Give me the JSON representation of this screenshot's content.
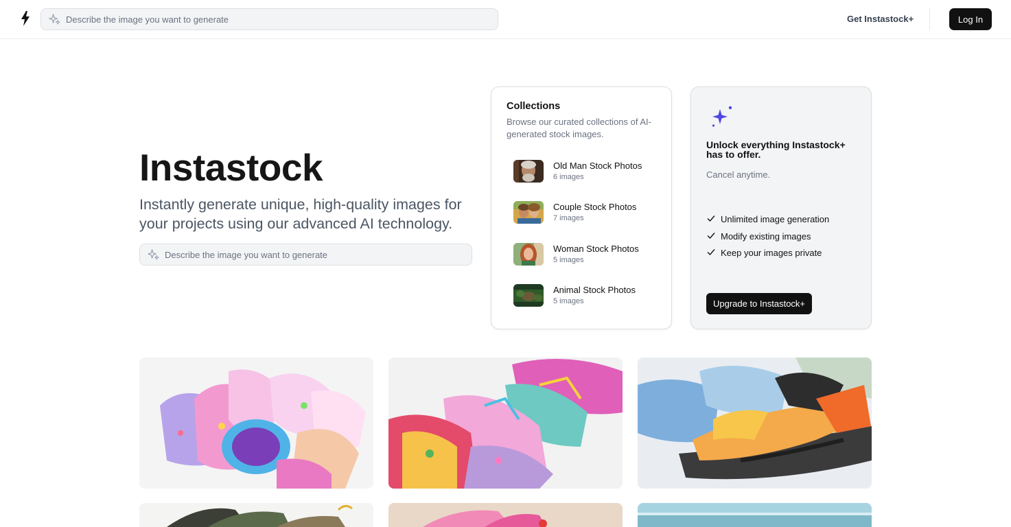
{
  "header": {
    "logo_icon": "lightning-bolt-icon",
    "search_placeholder": "Describe the image you want to generate",
    "get_plus_label": "Get Instastock+",
    "login_label": "Log In"
  },
  "hero": {
    "title": "Instastock",
    "subtitle": "Instantly generate unique, high-quality images for your projects using our advanced AI technology.",
    "search_placeholder": "Describe the image you want to generate"
  },
  "collections": {
    "title": "Collections",
    "description": "Browse our curated collections of AI-generated stock images.",
    "items": [
      {
        "name": "Old Man Stock Photos",
        "count": "6 images"
      },
      {
        "name": "Couple Stock Photos",
        "count": "7 images"
      },
      {
        "name": "Woman Stock Photos",
        "count": "5 images"
      },
      {
        "name": "Animal Stock Photos",
        "count": "5 images"
      }
    ]
  },
  "upgrade": {
    "icon": "sparkle-icon",
    "title": "Unlock everything Instastock+ has to offer.",
    "subtitle": "Cancel anytime.",
    "features": [
      "Unlimited image generation",
      "Modify existing images",
      "Keep your images private"
    ],
    "button_label": "Upgrade to Instastock+"
  },
  "gallery": {
    "images": [
      "colorful-patterned-sneakers",
      "glitter-sneakers-with-laces",
      "orange-kids-sandal",
      "dark-sandals",
      "pink-clog",
      "beach-scene"
    ]
  },
  "colors": {
    "accent": "#4f46e5",
    "button_dark": "#111111"
  }
}
